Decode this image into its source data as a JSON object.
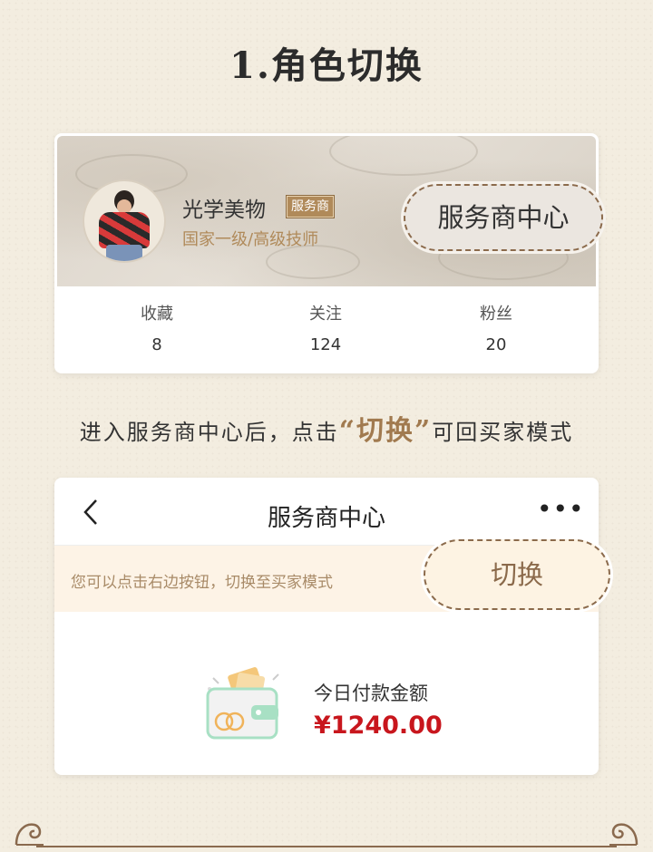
{
  "title": "1.角色切换",
  "profile_card": {
    "user_name": "光学美物",
    "badge": "服务商",
    "subtitle": "国家一级/高级技师",
    "highlight_button": "服务商中心",
    "stats": [
      {
        "label": "收藏",
        "value": "8"
      },
      {
        "label": "关注",
        "value": "124"
      },
      {
        "label": "粉丝",
        "value": "20"
      }
    ]
  },
  "caption": {
    "before": "进入服务商中心后，点击",
    "highlight": "“切换”",
    "after": "可回买家模式"
  },
  "service_card": {
    "back_icon": "chevron-left-icon",
    "nav_title": "服务商中心",
    "more_icon": "more-dots-icon",
    "more_glyph": "•••",
    "notice_text": "您可以点击右边按钮，切换至买家模式",
    "switch_button": "切换",
    "payment_label": "今日付款金额",
    "payment_amount": "¥1240.00"
  },
  "colors": {
    "accent_brown": "#8b6a4b",
    "amount_red": "#c8161d",
    "background": "#f3ede0"
  }
}
